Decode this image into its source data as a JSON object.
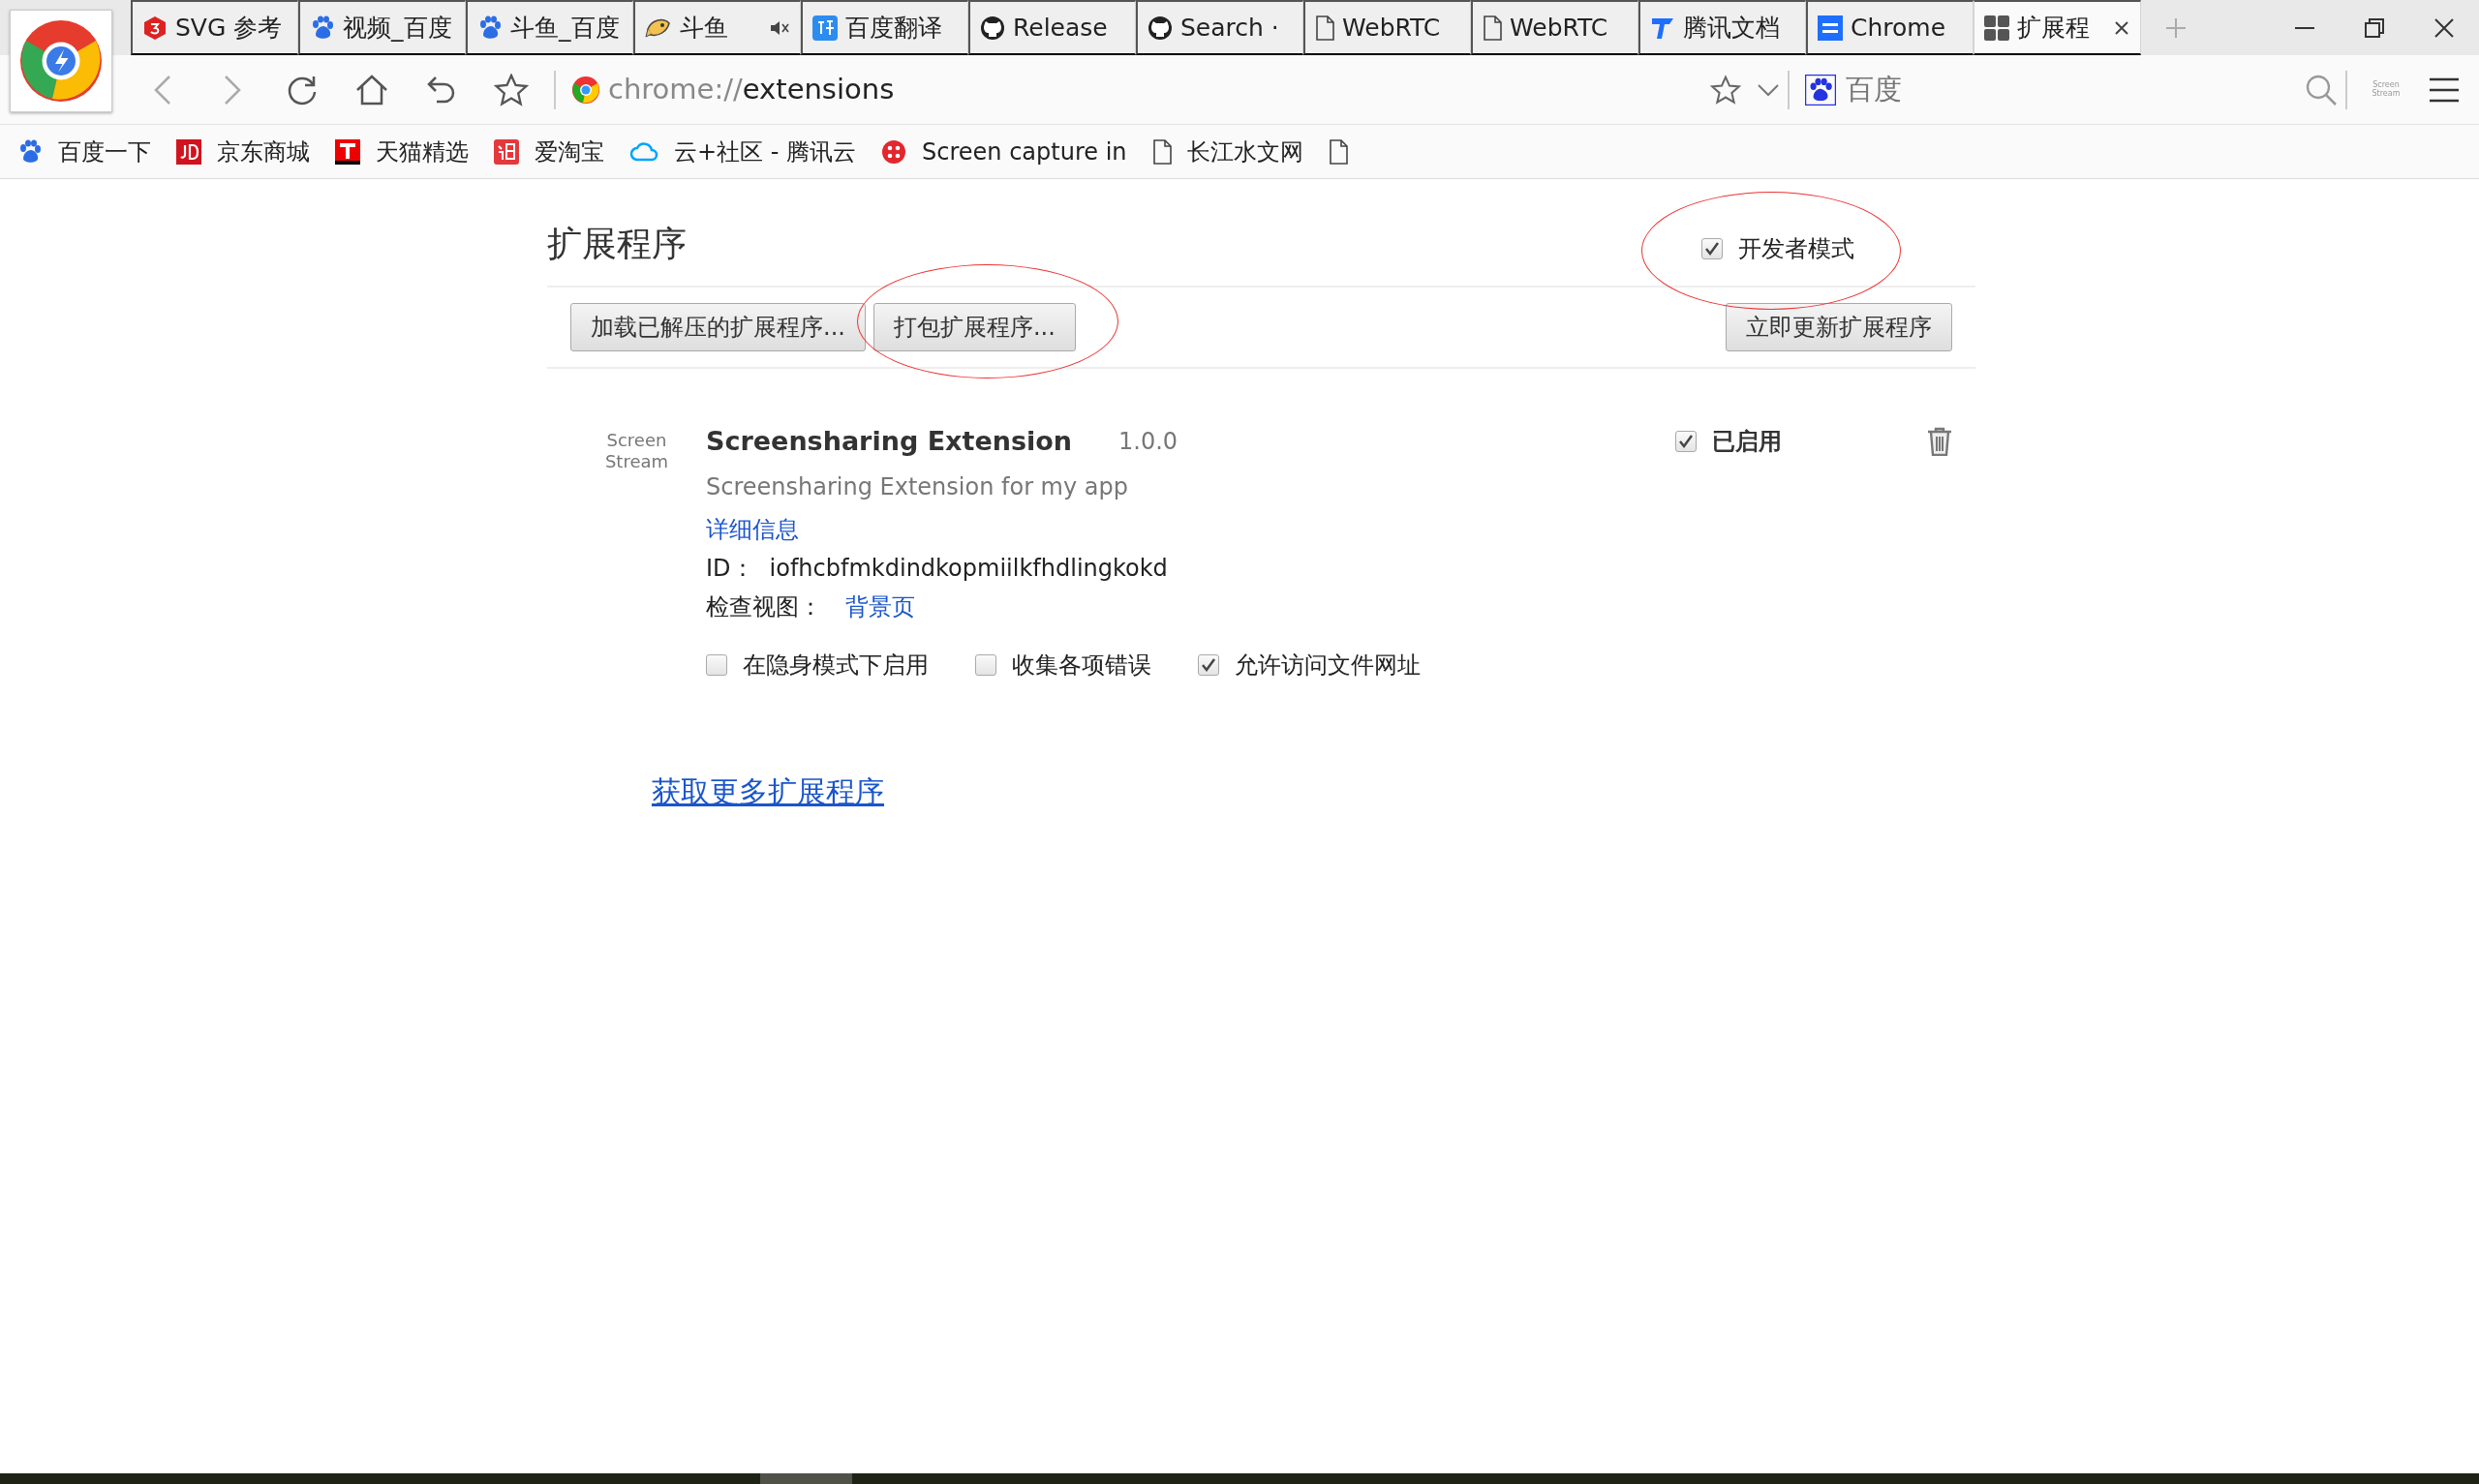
{
  "tabs": [
    {
      "kind": "svg",
      "label": "SVG 参考",
      "selected": false,
      "muted": false
    },
    {
      "kind": "paw",
      "label": "视频_百度",
      "selected": false,
      "muted": false
    },
    {
      "kind": "paw",
      "label": "斗鱼_百度",
      "selected": false,
      "muted": false
    },
    {
      "kind": "fish",
      "label": "斗鱼",
      "selected": false,
      "muted": true
    },
    {
      "kind": "translate",
      "label": "百度翻译",
      "selected": false,
      "muted": false
    },
    {
      "kind": "github",
      "label": "Release",
      "selected": false,
      "muted": false
    },
    {
      "kind": "github",
      "label": "Search ·",
      "selected": false,
      "muted": false
    },
    {
      "kind": "page",
      "label": "WebRTC",
      "selected": false,
      "muted": false
    },
    {
      "kind": "page",
      "label": "WebRTC",
      "selected": false,
      "muted": false
    },
    {
      "kind": "docs",
      "label": "腾讯文档",
      "selected": false,
      "muted": false
    },
    {
      "kind": "doc",
      "label": "Chrome",
      "selected": false,
      "muted": false
    },
    {
      "kind": "grid",
      "label": "扩展程",
      "selected": true,
      "muted": false
    }
  ],
  "address_bar": {
    "url_scheme": "chrome://",
    "url_path": "extensions"
  },
  "search_box": {
    "placeholder": "百度"
  },
  "extension_button": {
    "label": "Screen Stream"
  },
  "bookmarks": [
    {
      "kind": "paw",
      "label": "百度一下"
    },
    {
      "kind": "jd",
      "label": "京东商城"
    },
    {
      "kind": "tmall",
      "label": "天猫精选"
    },
    {
      "kind": "taobao",
      "label": "爱淘宝"
    },
    {
      "kind": "cloud",
      "label": "云+社区 - 腾讯云"
    },
    {
      "kind": "dots",
      "label": "Screen capture in"
    },
    {
      "kind": "page",
      "label": "长江水文网"
    },
    {
      "kind": "page"
    }
  ],
  "page": {
    "title": "扩展程序",
    "developer_mode": {
      "label": "开发者模式",
      "checked": true
    },
    "buttons": [
      {
        "label": "加载已解压的扩展程序..."
      },
      {
        "label": "打包扩展程序..."
      },
      {
        "label": "立即更新扩展程序"
      }
    ],
    "extensions": [
      {
        "icon_text": "Screen Stream",
        "name": "Screensharing Extension",
        "version": "1.0.0",
        "description": "Screensharing Extension for my app",
        "details_link": "详细信息",
        "id_label": "ID：",
        "id": "iofhcbfmkdindkopmiilkfhdlingkokd",
        "views_label": "检查视图：",
        "views_link": "背景页",
        "enabled": {
          "label": "已启用",
          "checked": true
        },
        "options": [
          {
            "label": "在隐身模式下启用",
            "checked": false
          },
          {
            "label": "收集各项错误",
            "checked": false
          },
          {
            "label": "允许访问文件网址",
            "checked": true
          }
        ]
      }
    ],
    "more_link": "获取更多扩展程序"
  }
}
